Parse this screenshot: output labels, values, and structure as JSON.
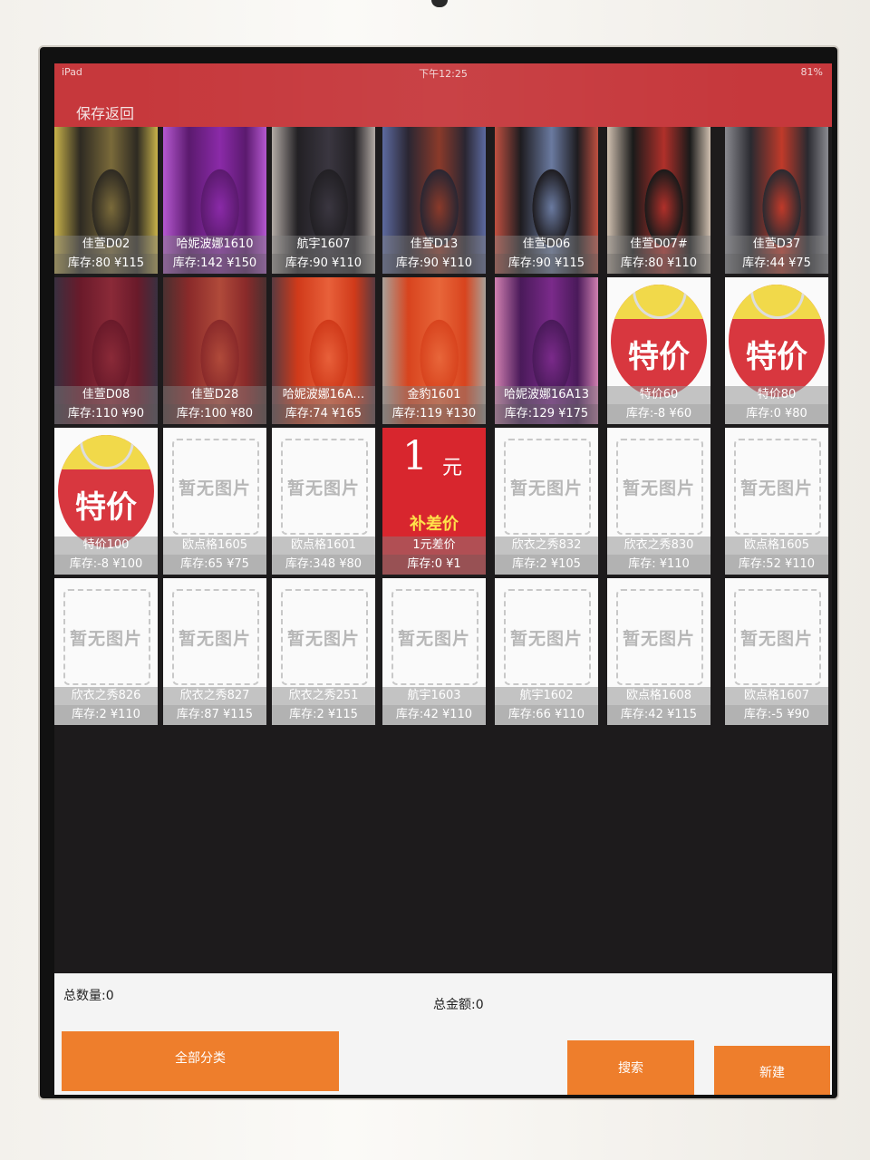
{
  "status_bar": {
    "device": "iPad",
    "time": "下午12:25",
    "battery": "81%"
  },
  "nav": {
    "back_label": "保存返回"
  },
  "products": [
    {
      "name": "佳萱D02",
      "stock": "库存:80",
      "price": "¥115",
      "image": "photo",
      "colors": [
        "#2e2a22",
        "#7a6a3a",
        "#c9b24a"
      ]
    },
    {
      "name": "哈妮波娜1610",
      "stock": "库存:142",
      "price": "¥150",
      "image": "photo",
      "colors": [
        "#5b1a6e",
        "#8a2aa8",
        "#b558d0"
      ]
    },
    {
      "name": "航宇1607",
      "stock": "库存:90",
      "price": "¥110",
      "image": "photo",
      "colors": [
        "#222024",
        "#3a3640",
        "#b2aaa4"
      ]
    },
    {
      "name": "佳萱D13",
      "stock": "库存:90",
      "price": "¥110",
      "image": "photo",
      "colors": [
        "#2a2632",
        "#8a3a2a",
        "#5d6aa0"
      ]
    },
    {
      "name": "佳萱D06",
      "stock": "库存:90",
      "price": "¥115",
      "image": "photo",
      "colors": [
        "#1e1c20",
        "#6a7aa0",
        "#c05040"
      ]
    },
    {
      "name": "佳萱D07#",
      "stock": "库存:80",
      "price": "¥110",
      "image": "photo",
      "colors": [
        "#1a1a1a",
        "#b0302a",
        "#d0c0b0"
      ]
    },
    {
      "name": "佳萱D37",
      "stock": "库存:44",
      "price": "¥75",
      "image": "photo",
      "colors": [
        "#2a2a30",
        "#c03a2a",
        "#8a8a90"
      ]
    },
    {
      "name": "佳萱D08",
      "stock": "库存:110",
      "price": "¥90",
      "image": "photo",
      "colors": [
        "#6a1a2a",
        "#8a2a38",
        "#3a3040"
      ]
    },
    {
      "name": "佳萱D28",
      "stock": "库存:100",
      "price": "¥80",
      "image": "photo",
      "colors": [
        "#8a2a2a",
        "#b04a3a",
        "#4a3030"
      ]
    },
    {
      "name": "哈妮波娜16A…",
      "stock": "库存:74",
      "price": "¥165",
      "image": "photo",
      "colors": [
        "#d03a1a",
        "#e8603a",
        "#5a3a40"
      ]
    },
    {
      "name": "金豹1601",
      "stock": "库存:119",
      "price": "¥130",
      "image": "photo",
      "colors": [
        "#d8441e",
        "#e8663a",
        "#a8a098"
      ]
    },
    {
      "name": "哈妮波娜16A13",
      "stock": "库存:129",
      "price": "¥175",
      "image": "photo",
      "colors": [
        "#4a1a5a",
        "#7a2a8a",
        "#d080b0"
      ]
    },
    {
      "name": "特价60",
      "stock": "库存:-8",
      "price": "¥60",
      "image": "sale",
      "label": "特价"
    },
    {
      "name": "特价80",
      "stock": "库存:0",
      "price": "¥80",
      "image": "sale",
      "label": "特价"
    },
    {
      "name": "特价100",
      "stock": "库存:-8",
      "price": "¥100",
      "image": "sale",
      "label": "特价"
    },
    {
      "name": "欧点格1605",
      "stock": "库存:65",
      "price": "¥75",
      "image": "placeholder",
      "label": "暂无图片"
    },
    {
      "name": "欧点格1601",
      "stock": "库存:348",
      "price": "¥80",
      "image": "placeholder",
      "label": "暂无图片"
    },
    {
      "name": "1元差价",
      "stock": "库存:0",
      "price": "¥1",
      "image": "yuan",
      "big": "1",
      "small": "元",
      "sub": "补差价"
    },
    {
      "name": "欣衣之秀832",
      "stock": "库存:2",
      "price": "¥105",
      "image": "placeholder",
      "label": "暂无图片"
    },
    {
      "name": "欣衣之秀830",
      "stock": "库存:",
      "price": "¥110",
      "image": "placeholder",
      "label": "暂无图片"
    },
    {
      "name": "欧点格1605",
      "stock": "库存:52",
      "price": "¥110",
      "image": "placeholder",
      "label": "暂无图片"
    },
    {
      "name": "欣衣之秀826",
      "stock": "库存:2",
      "price": "¥110",
      "image": "placeholder",
      "label": "暂无图片"
    },
    {
      "name": "欣衣之秀827",
      "stock": "库存:87",
      "price": "¥115",
      "image": "placeholder",
      "label": "暂无图片"
    },
    {
      "name": "欣衣之秀251",
      "stock": "库存:2",
      "price": "¥115",
      "image": "placeholder",
      "label": "暂无图片"
    },
    {
      "name": "航宇1603",
      "stock": "库存:42",
      "price": "¥110",
      "image": "placeholder",
      "label": "暂无图片"
    },
    {
      "name": "航宇1602",
      "stock": "库存:66",
      "price": "¥110",
      "image": "placeholder",
      "label": "暂无图片"
    },
    {
      "name": "欧点格1608",
      "stock": "库存:42",
      "price": "¥115",
      "image": "placeholder",
      "label": "暂无图片"
    },
    {
      "name": "欧点格1607",
      "stock": "库存:-5",
      "price": "¥90",
      "image": "placeholder",
      "label": "暂无图片"
    }
  ],
  "footer": {
    "total_qty": "总数量:0",
    "total_amount": "总金额:0",
    "category_button": "全部分类",
    "search_button": "搜索",
    "new_button": "新建"
  },
  "colors": {
    "accent": "#c6383c",
    "button": "#ee7e2c",
    "sale_red": "#d8373f",
    "sale_yellow": "#f1d94a"
  }
}
